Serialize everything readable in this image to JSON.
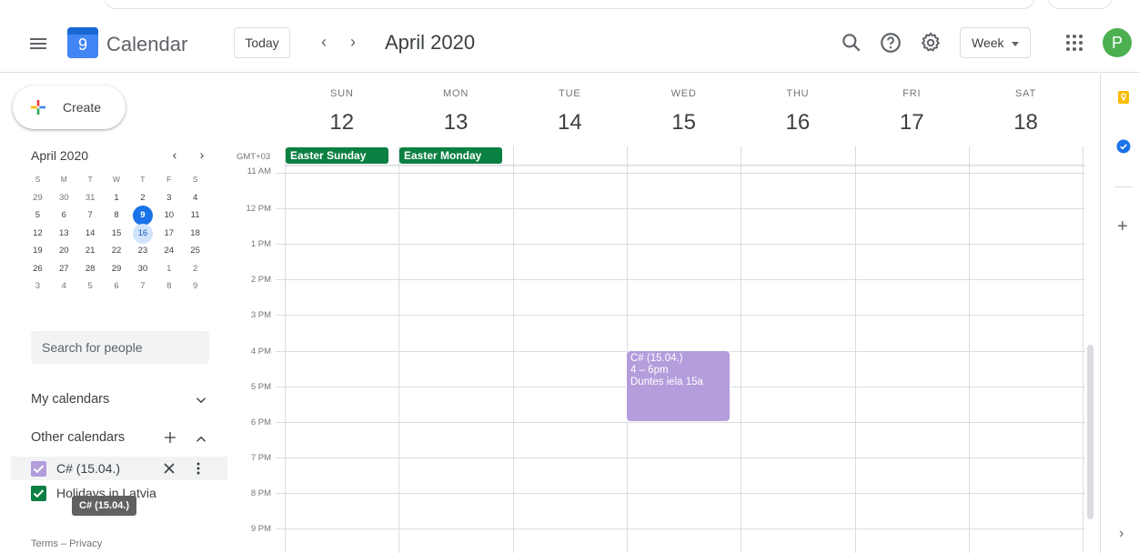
{
  "header": {
    "app_title": "Calendar",
    "logo_day": "9",
    "today_label": "Today",
    "prev_label": "‹",
    "next_label": "›",
    "month_title": "April 2020",
    "view_label": "Week",
    "avatar_letter": "P"
  },
  "sidebar": {
    "create_label": "Create",
    "mini_title": "April 2020",
    "mini_prev": "‹",
    "mini_next": "›",
    "weekdays": [
      "S",
      "M",
      "T",
      "W",
      "T",
      "F",
      "S"
    ],
    "weeks": [
      [
        "29",
        "30",
        "31",
        "1",
        "2",
        "3",
        "4"
      ],
      [
        "5",
        "6",
        "7",
        "8",
        "9",
        "10",
        "11"
      ],
      [
        "12",
        "13",
        "14",
        "15",
        "16",
        "17",
        "18"
      ],
      [
        "19",
        "20",
        "21",
        "22",
        "23",
        "24",
        "25"
      ],
      [
        "26",
        "27",
        "28",
        "29",
        "30",
        "1",
        "2"
      ],
      [
        "3",
        "4",
        "5",
        "6",
        "7",
        "8",
        "9"
      ]
    ],
    "today_day": "9",
    "selected_day": "16",
    "search_placeholder": "Search for people",
    "my_calendars_label": "My calendars",
    "other_calendars_label": "Other calendars",
    "calendars": [
      {
        "label": "C# (15.04.)",
        "color": "#b39ddb"
      },
      {
        "label": "Holidays in Latvia",
        "color": "#0b8043"
      }
    ],
    "tooltip": "C# (15.04.)",
    "footer": "Terms – Privacy"
  },
  "week": {
    "days": [
      {
        "dow": "SUN",
        "num": "12"
      },
      {
        "dow": "MON",
        "num": "13"
      },
      {
        "dow": "TUE",
        "num": "14"
      },
      {
        "dow": "WED",
        "num": "15"
      },
      {
        "dow": "THU",
        "num": "16"
      },
      {
        "dow": "FRI",
        "num": "17"
      },
      {
        "dow": "SAT",
        "num": "18"
      }
    ],
    "timezone": "GMT+03",
    "times": [
      "11 AM",
      "12 PM",
      "1 PM",
      "2 PM",
      "3 PM",
      "4 PM",
      "5 PM",
      "6 PM",
      "7 PM",
      "8 PM",
      "9 PM"
    ],
    "allday_events": [
      {
        "title": "Easter Sunday",
        "color": "#0b8043"
      },
      {
        "title": "Easter Monday",
        "color": "#0b8043"
      }
    ],
    "event": {
      "title": "C# (15.04.)",
      "time": "4 – 6pm",
      "location": "Duntes iela 15a",
      "color": "#b39ddb"
    }
  },
  "colors": {
    "accent": "#1a73e8",
    "holiday_green": "#0b8043",
    "event_purple": "#b39ddb"
  }
}
